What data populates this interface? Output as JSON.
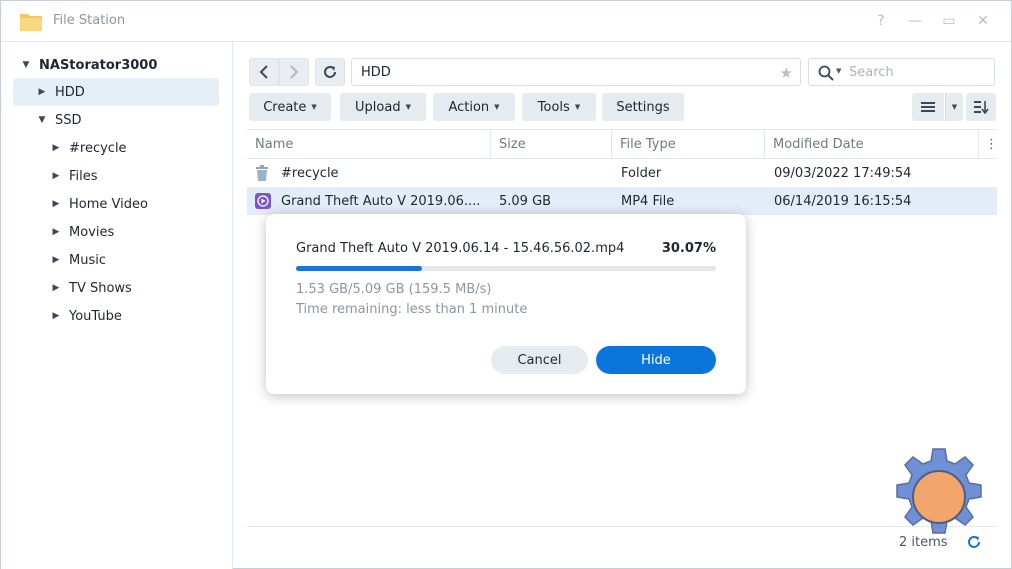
{
  "app": {
    "title": "File Station"
  },
  "window_controls": {
    "help": "?",
    "minimize": "—",
    "maximize": "▭",
    "close": "✕"
  },
  "sidebar": {
    "root": "NAStorator3000",
    "items": [
      {
        "label": "HDD",
        "level": 1,
        "selected": true
      },
      {
        "label": "SSD",
        "level": 1,
        "expanded": true
      },
      {
        "label": "#recycle",
        "level": 2
      },
      {
        "label": "Files",
        "level": 2
      },
      {
        "label": "Home Video",
        "level": 2
      },
      {
        "label": "Movies",
        "level": 2
      },
      {
        "label": "Music",
        "level": 2
      },
      {
        "label": "TV Shows",
        "level": 2
      },
      {
        "label": "YouTube",
        "level": 2
      }
    ]
  },
  "path": {
    "value": "HDD"
  },
  "search": {
    "placeholder": "Search"
  },
  "toolbar": {
    "create": "Create",
    "upload": "Upload",
    "action": "Action",
    "tools": "Tools",
    "settings": "Settings"
  },
  "list": {
    "columns": [
      "Name",
      "Size",
      "File Type",
      "Modified Date"
    ],
    "rows": [
      {
        "name": "#recycle",
        "size": "",
        "type": "Folder",
        "modified": "09/03/2022 17:49:54",
        "icon": "trash-icon"
      },
      {
        "name": "Grand Theft Auto V 2019.06....",
        "size": "5.09 GB",
        "type": "MP4 File",
        "modified": "06/14/2019 16:15:54",
        "icon": "video-file-icon"
      }
    ],
    "footer_count": "2 items"
  },
  "dialog": {
    "filename": "Grand Theft Auto V 2019.06.14 - 15.46.56.02.mp4",
    "percent": "30.07%",
    "progress": 0.3007,
    "stats": "1.53 GB/5.09 GB (159.5 MB/s)",
    "remaining": "Time remaining: less than 1 minute",
    "cancel": "Cancel",
    "hide": "Hide"
  },
  "colors": {
    "accent": "#0a75dd",
    "progress": "#1a73d6",
    "selection": "#e3edf8",
    "gear_body": "#6f8fd6",
    "gear_center": "#f3a56b"
  }
}
